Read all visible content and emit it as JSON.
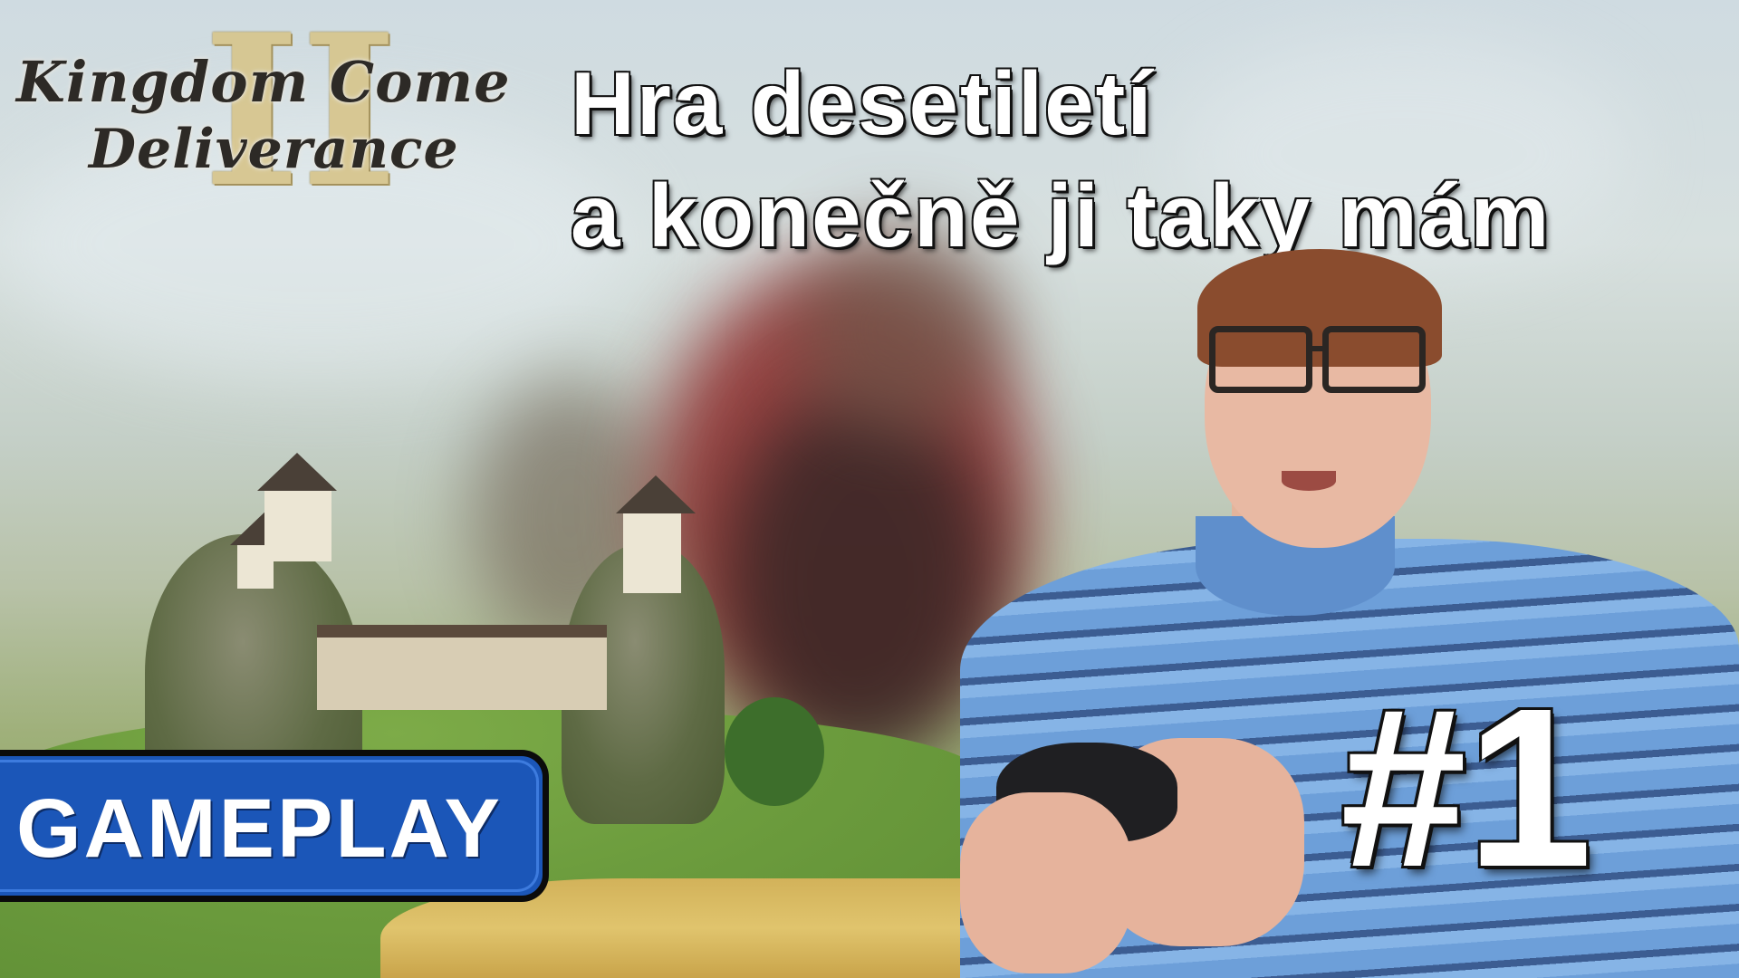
{
  "logo": {
    "line1": "Kingdom Come",
    "line2": "Deliverance",
    "numeral": "II"
  },
  "headline": {
    "line1": "Hra desetiletí",
    "line2": "a konečně ji taky mám"
  },
  "badge": {
    "label": "GAMEPLAY",
    "color": "#1b56b8"
  },
  "episode": {
    "label": "#1"
  }
}
